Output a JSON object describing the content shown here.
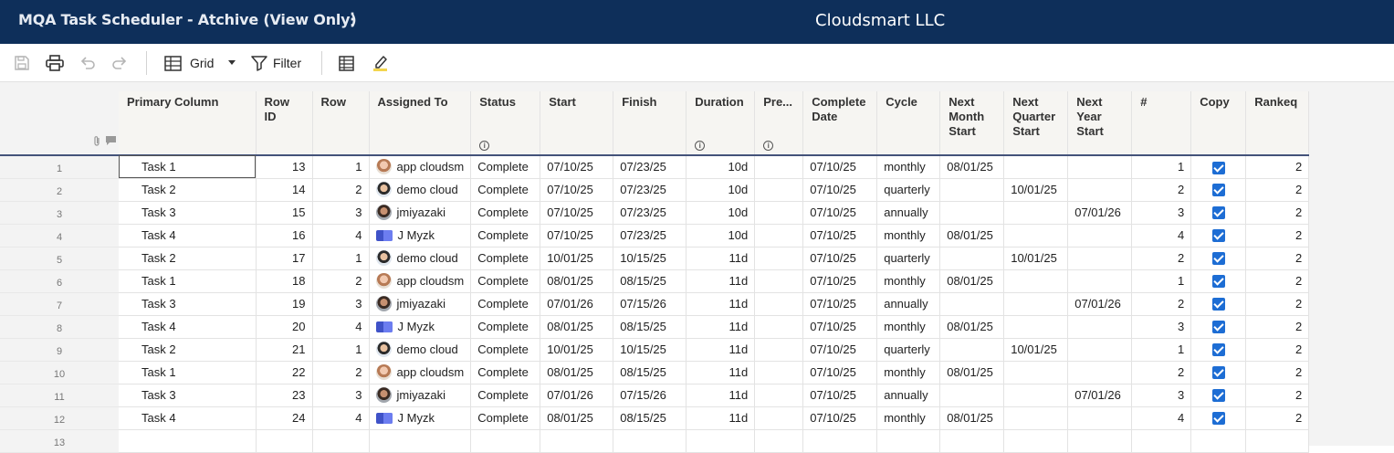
{
  "header": {
    "app_title": "MQA Task Scheduler - Atchive (View Only)",
    "more_glyph": "⋮",
    "workspace_name": "Cloudsmart LLC",
    "colors": {
      "topbar": "#0e2f5a",
      "checkbox": "#1d6dd4",
      "header_border": "#44537a"
    }
  },
  "toolbar": {
    "grid_label": "Grid",
    "filter_label": "Filter",
    "icons": [
      "save-icon",
      "print-icon",
      "undo-icon",
      "redo-icon",
      "grid-view-icon",
      "filter-icon",
      "column-settings-icon",
      "highlight-icon"
    ]
  },
  "columns": [
    {
      "label": "Primary Column"
    },
    {
      "label": "Row ID"
    },
    {
      "label": "Row"
    },
    {
      "label": "Assigned To"
    },
    {
      "label": "Status",
      "info": true
    },
    {
      "label": "Start"
    },
    {
      "label": "Finish"
    },
    {
      "label": "Duration",
      "info": true
    },
    {
      "label": "Pre...",
      "info": true
    },
    {
      "label": "Complete Date"
    },
    {
      "label": "Cycle"
    },
    {
      "label": "Next Month Start"
    },
    {
      "label": "Next Quarter Start"
    },
    {
      "label": "Next Year Start"
    },
    {
      "label": "#"
    },
    {
      "label": "Copy"
    },
    {
      "label": "Rankeq"
    }
  ],
  "rows": [
    {
      "n": "1",
      "task": "Task 1",
      "row_id": "13",
      "row": "1",
      "assigned": "app cloudsm",
      "avatar": "woman",
      "status": "Complete",
      "start": "07/10/25",
      "finish": "07/23/25",
      "duration": "10d",
      "pre": "",
      "complete": "07/10/25",
      "cycle": "monthly",
      "nm": "08/01/25",
      "nq": "",
      "ny": "",
      "hash": "1",
      "copy": true,
      "rankeq": "2"
    },
    {
      "n": "2",
      "task": "Task 2",
      "row_id": "14",
      "row": "2",
      "assigned": "demo cloud",
      "avatar": "man",
      "status": "Complete",
      "start": "07/10/25",
      "finish": "07/23/25",
      "duration": "10d",
      "pre": "",
      "complete": "07/10/25",
      "cycle": "quarterly",
      "nm": "",
      "nq": "10/01/25",
      "ny": "",
      "hash": "2",
      "copy": true,
      "rankeq": "2"
    },
    {
      "n": "3",
      "task": "Task 3",
      "row_id": "15",
      "row": "3",
      "assigned": "jmiyazaki",
      "avatar": "dark",
      "status": "Complete",
      "start": "07/10/25",
      "finish": "07/23/25",
      "duration": "10d",
      "pre": "",
      "complete": "07/10/25",
      "cycle": "annually",
      "nm": "",
      "nq": "",
      "ny": "07/01/26",
      "hash": "3",
      "copy": true,
      "rankeq": "2"
    },
    {
      "n": "4",
      "task": "Task 4",
      "row_id": "16",
      "row": "4",
      "assigned": "J Myzk",
      "avatar": "bot",
      "status": "Complete",
      "start": "07/10/25",
      "finish": "07/23/25",
      "duration": "10d",
      "pre": "",
      "complete": "07/10/25",
      "cycle": "monthly",
      "nm": "08/01/25",
      "nq": "",
      "ny": "",
      "hash": "4",
      "copy": true,
      "rankeq": "2"
    },
    {
      "n": "5",
      "task": "Task 2",
      "row_id": "17",
      "row": "1",
      "assigned": "demo cloud",
      "avatar": "man",
      "status": "Complete",
      "start": "10/01/25",
      "finish": "10/15/25",
      "duration": "11d",
      "pre": "",
      "complete": "07/10/25",
      "cycle": "quarterly",
      "nm": "",
      "nq": "10/01/25",
      "ny": "",
      "hash": "2",
      "copy": true,
      "rankeq": "2"
    },
    {
      "n": "6",
      "task": "Task 1",
      "row_id": "18",
      "row": "2",
      "assigned": "app cloudsm",
      "avatar": "woman",
      "status": "Complete",
      "start": "08/01/25",
      "finish": "08/15/25",
      "duration": "11d",
      "pre": "",
      "complete": "07/10/25",
      "cycle": "monthly",
      "nm": "08/01/25",
      "nq": "",
      "ny": "",
      "hash": "1",
      "copy": true,
      "rankeq": "2"
    },
    {
      "n": "7",
      "task": "Task 3",
      "row_id": "19",
      "row": "3",
      "assigned": "jmiyazaki",
      "avatar": "dark",
      "status": "Complete",
      "start": "07/01/26",
      "finish": "07/15/26",
      "duration": "11d",
      "pre": "",
      "complete": "07/10/25",
      "cycle": "annually",
      "nm": "",
      "nq": "",
      "ny": "07/01/26",
      "hash": "2",
      "copy": true,
      "rankeq": "2"
    },
    {
      "n": "8",
      "task": "Task 4",
      "row_id": "20",
      "row": "4",
      "assigned": "J Myzk",
      "avatar": "bot",
      "status": "Complete",
      "start": "08/01/25",
      "finish": "08/15/25",
      "duration": "11d",
      "pre": "",
      "complete": "07/10/25",
      "cycle": "monthly",
      "nm": "08/01/25",
      "nq": "",
      "ny": "",
      "hash": "3",
      "copy": true,
      "rankeq": "2"
    },
    {
      "n": "9",
      "task": "Task 2",
      "row_id": "21",
      "row": "1",
      "assigned": "demo cloud",
      "avatar": "man",
      "status": "Complete",
      "start": "10/01/25",
      "finish": "10/15/25",
      "duration": "11d",
      "pre": "",
      "complete": "07/10/25",
      "cycle": "quarterly",
      "nm": "",
      "nq": "10/01/25",
      "ny": "",
      "hash": "1",
      "copy": true,
      "rankeq": "2"
    },
    {
      "n": "10",
      "task": "Task 1",
      "row_id": "22",
      "row": "2",
      "assigned": "app cloudsm",
      "avatar": "woman",
      "status": "Complete",
      "start": "08/01/25",
      "finish": "08/15/25",
      "duration": "11d",
      "pre": "",
      "complete": "07/10/25",
      "cycle": "monthly",
      "nm": "08/01/25",
      "nq": "",
      "ny": "",
      "hash": "2",
      "copy": true,
      "rankeq": "2"
    },
    {
      "n": "11",
      "task": "Task 3",
      "row_id": "23",
      "row": "3",
      "assigned": "jmiyazaki",
      "avatar": "dark",
      "status": "Complete",
      "start": "07/01/26",
      "finish": "07/15/26",
      "duration": "11d",
      "pre": "",
      "complete": "07/10/25",
      "cycle": "annually",
      "nm": "",
      "nq": "",
      "ny": "07/01/26",
      "hash": "3",
      "copy": true,
      "rankeq": "2"
    },
    {
      "n": "12",
      "task": "Task 4",
      "row_id": "24",
      "row": "4",
      "assigned": "J Myzk",
      "avatar": "bot",
      "status": "Complete",
      "start": "08/01/25",
      "finish": "08/15/25",
      "duration": "11d",
      "pre": "",
      "complete": "07/10/25",
      "cycle": "monthly",
      "nm": "08/01/25",
      "nq": "",
      "ny": "",
      "hash": "4",
      "copy": true,
      "rankeq": "2"
    }
  ],
  "empty_row_number": "13"
}
